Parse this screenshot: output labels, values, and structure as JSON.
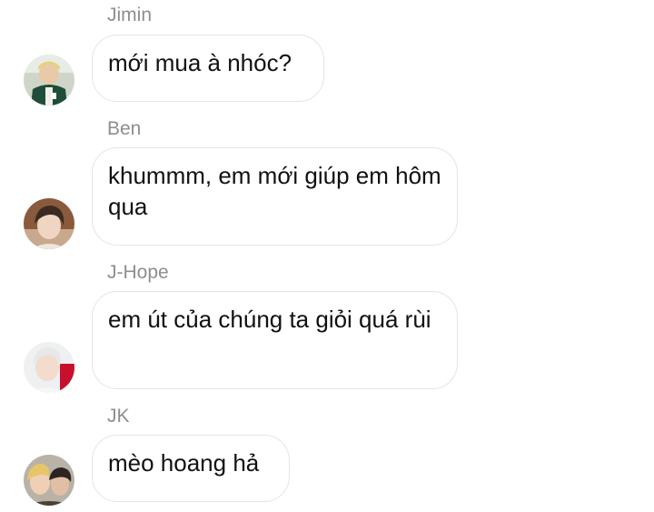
{
  "messages": [
    {
      "sender": "Jimin",
      "text": "mới mua à nhóc?",
      "avatar": "jimin-avatar"
    },
    {
      "sender": "Ben",
      "text": "khummm, em mới giúp em hôm qua",
      "avatar": "ben-avatar"
    },
    {
      "sender": "J-Hope",
      "text": "em út của chúng ta giỏi quá rùi",
      "avatar": "jhope-avatar"
    },
    {
      "sender": "JK",
      "text": "mèo hoang hả",
      "avatar": "jk-avatar"
    }
  ],
  "colors": {
    "sender_name": "#8e8e8e",
    "bubble_border": "#e4e4e4",
    "message_text": "#111111",
    "background": "#ffffff"
  }
}
